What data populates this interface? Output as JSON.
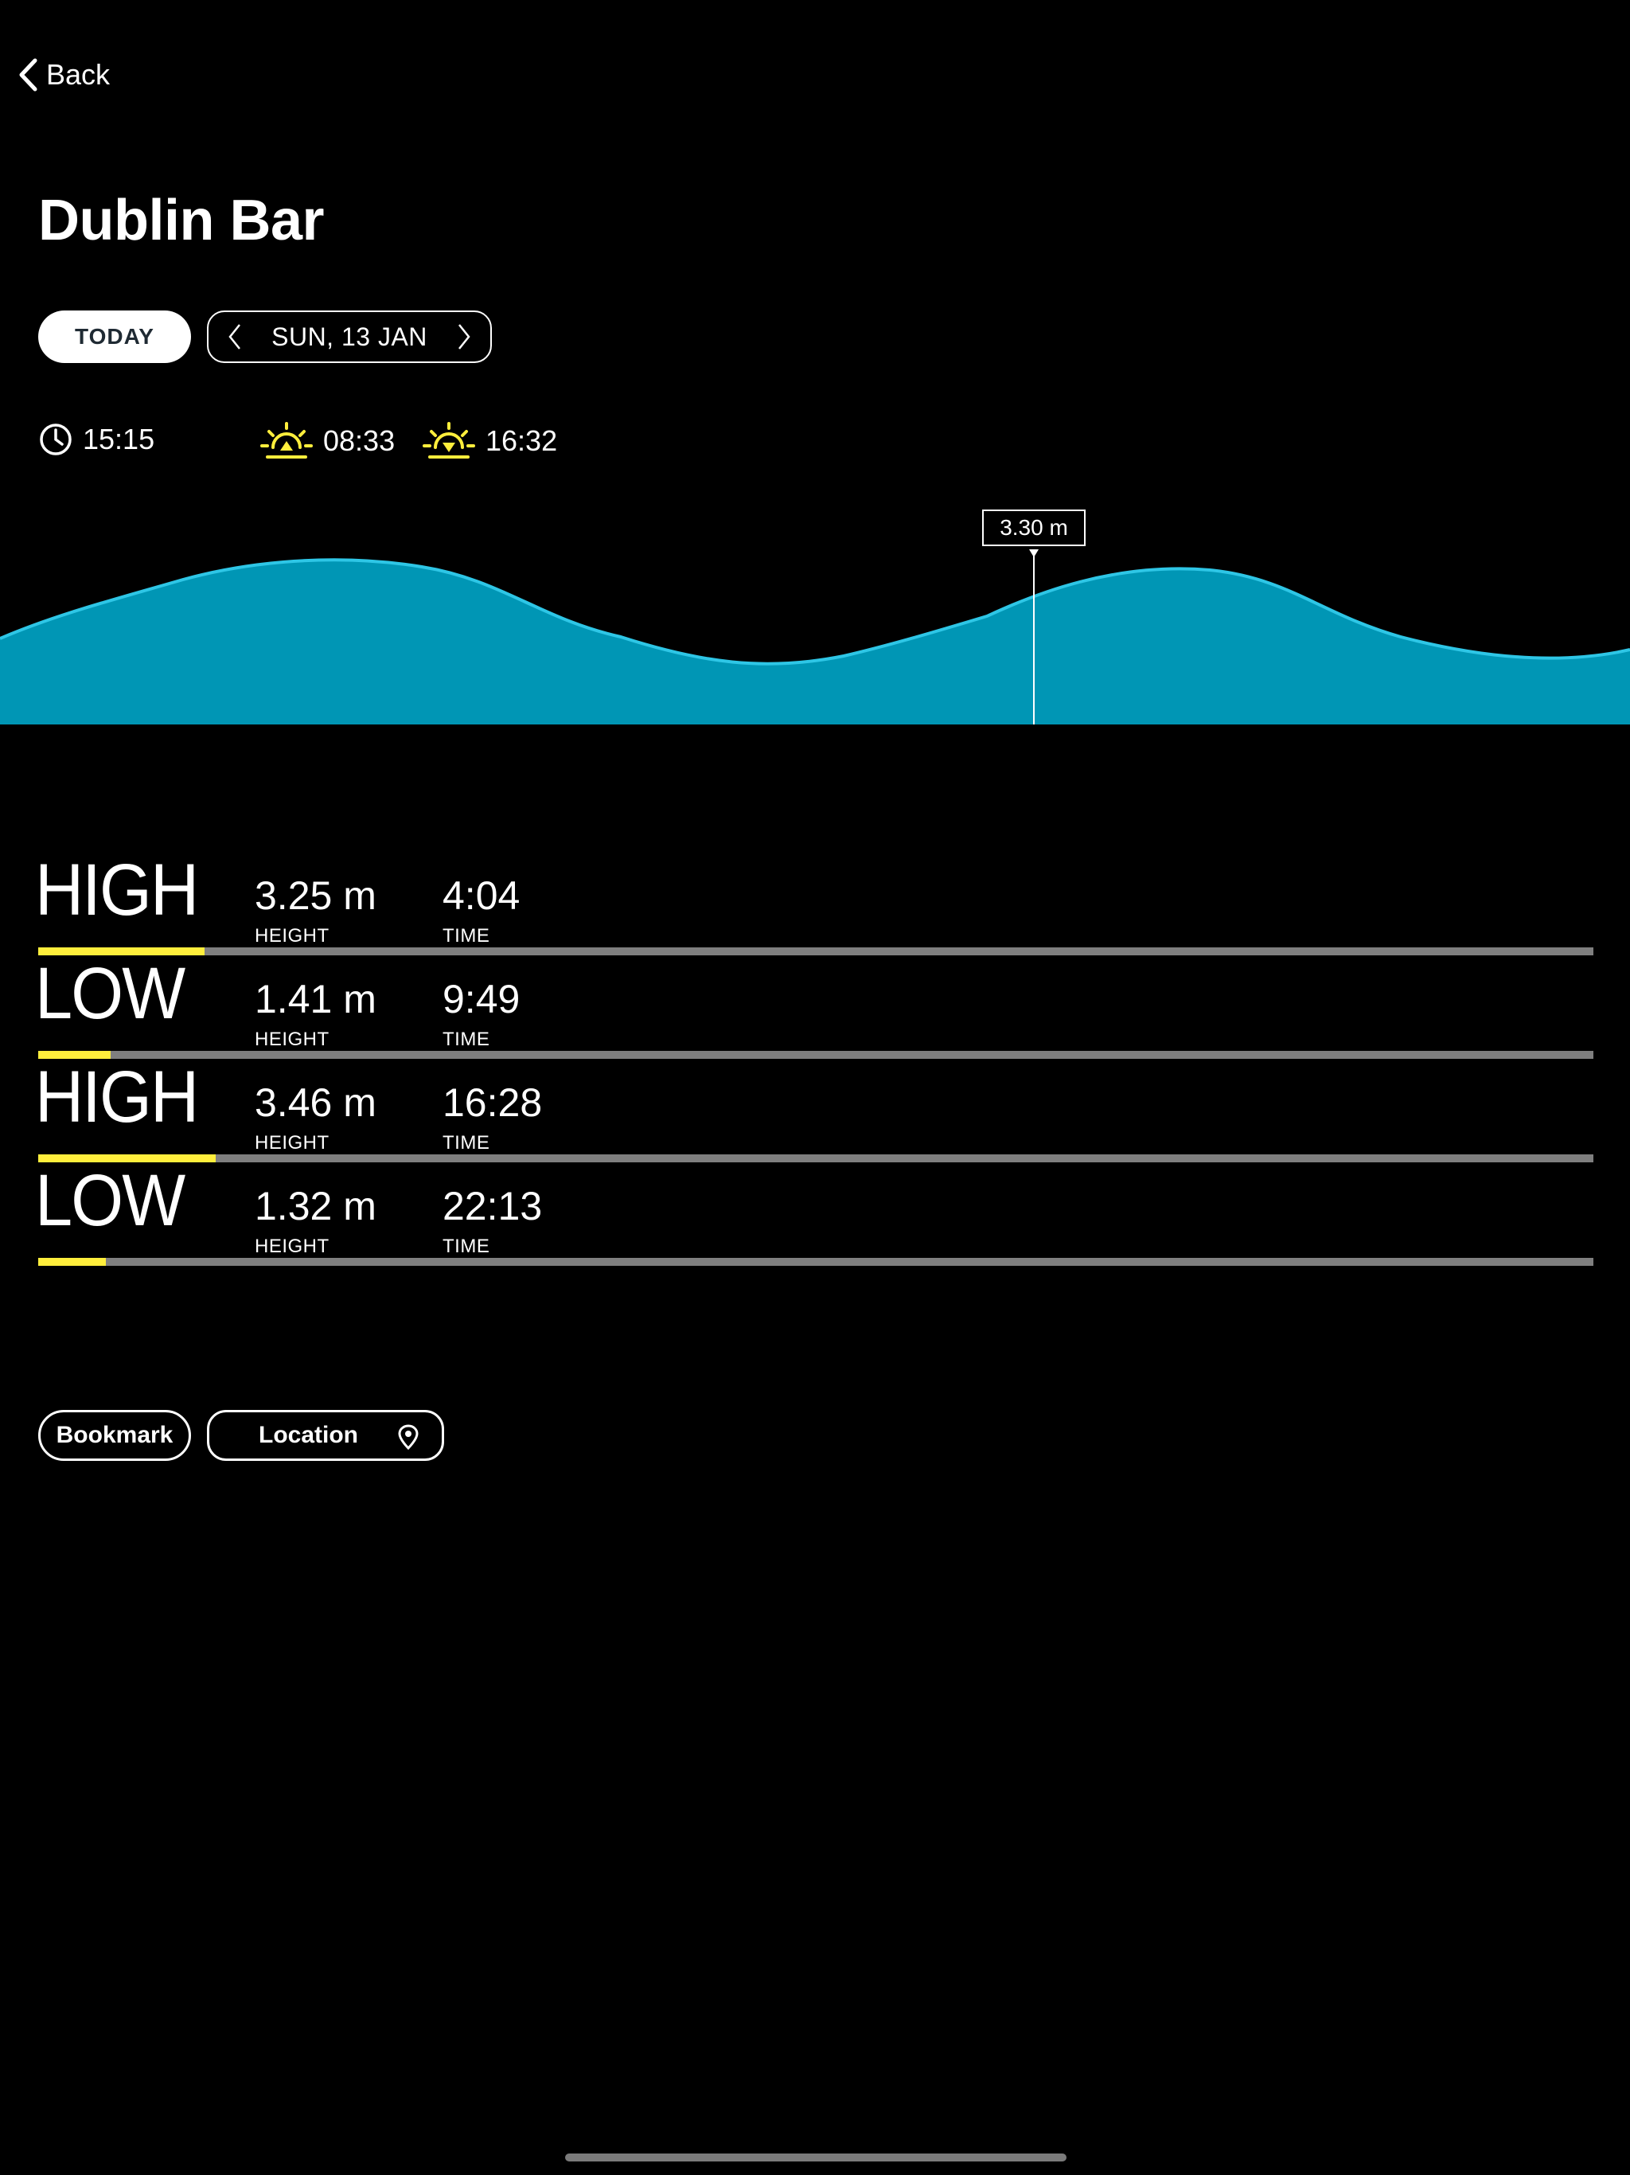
{
  "nav": {
    "back_label": "Back"
  },
  "station": {
    "name": "Dublin Bar"
  },
  "date_controls": {
    "today_label": "TODAY",
    "date_label": "SUN, 13 JAN"
  },
  "info": {
    "current_time": "15:15",
    "sunrise": "08:33",
    "sunset": "16:32"
  },
  "colors": {
    "tide_fill": "#0096b5",
    "tide_line": "#2ec6e6",
    "accent_yellow": "#ffee3c",
    "track_gray": "#7f7f7f"
  },
  "chart_data": {
    "type": "area",
    "cursor_label": "3.30 m",
    "extremes": [
      {
        "time": "4:04",
        "height_m": 3.25
      },
      {
        "time": "9:49",
        "height_m": 1.41
      },
      {
        "time": "16:28",
        "height_m": 3.46
      },
      {
        "time": "22:13",
        "height_m": 1.32
      }
    ]
  },
  "tides": [
    {
      "kind": "HIGH",
      "height": "3.25 m",
      "height_label": "HEIGHT",
      "time": "4:04",
      "time_label": "TIME",
      "level": 3.25
    },
    {
      "kind": "LOW",
      "height": "1.41 m",
      "height_label": "HEIGHT",
      "time": "9:49",
      "time_label": "TIME",
      "level": 1.41
    },
    {
      "kind": "HIGH",
      "height": "3.46 m",
      "height_label": "HEIGHT",
      "time": "16:28",
      "time_label": "TIME",
      "level": 3.46
    },
    {
      "kind": "LOW",
      "height": "1.32 m",
      "height_label": "HEIGHT",
      "time": "22:13",
      "time_label": "TIME",
      "level": 1.32
    }
  ],
  "actions": {
    "bookmark_label": "Bookmark",
    "location_label": "Location"
  },
  "icons": {
    "back": "chevron-left-icon",
    "clock": "clock-icon",
    "sunrise": "sunrise-icon",
    "sunset": "sunset-icon",
    "pin": "map-pin-icon"
  }
}
